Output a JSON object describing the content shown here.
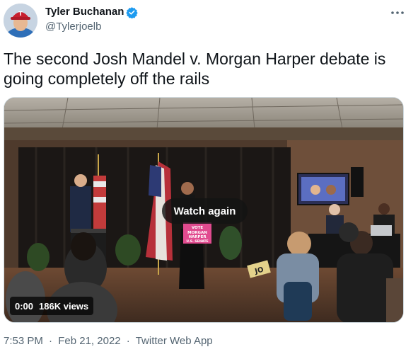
{
  "author": {
    "name": "Tyler Buchanan",
    "handle": "@Tylerjoelb",
    "verified": true,
    "avatar_cap_letter": "T"
  },
  "tweet": {
    "text": "The second Josh Mandel v. Morgan Harper debate is going completely off the rails"
  },
  "media": {
    "overlay_button": "Watch again",
    "time": "0:00",
    "views": "186K views",
    "sign_text": [
      "VOTE",
      "MORGAN",
      "HARPER",
      "U.S. SENATE"
    ],
    "placard_text": "JO"
  },
  "meta": {
    "time": "7:53 PM",
    "date": "Feb 21, 2022",
    "separator": "·",
    "source": "Twitter Web App"
  },
  "colors": {
    "text_primary": "#0f1419",
    "text_secondary": "#536471",
    "verified_blue": "#1d9bf0",
    "border": "#cfd9de"
  },
  "icons": {
    "verified": "verified-badge-icon",
    "more": "more-dots-icon"
  }
}
